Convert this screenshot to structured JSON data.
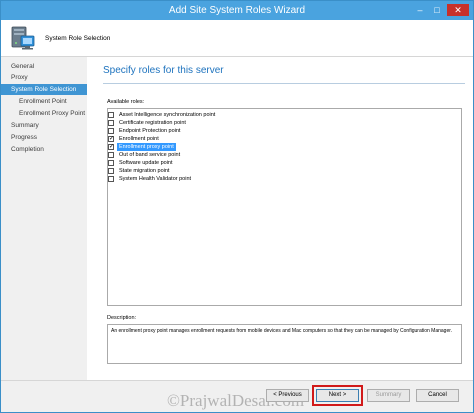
{
  "window": {
    "title": "Add Site System Roles Wizard",
    "controls": {
      "minimize": "–",
      "maximize": "□",
      "close": "✕"
    }
  },
  "header": {
    "title": "System Role Selection",
    "icon": "server-computer-icon"
  },
  "nav": {
    "items": [
      {
        "label": "General"
      },
      {
        "label": "Proxy"
      },
      {
        "label": "System Role Selection",
        "active": true
      },
      {
        "label": "Enrollment Point"
      },
      {
        "label": "Enrollment Proxy Point"
      },
      {
        "label": "Summary"
      },
      {
        "label": "Progress"
      },
      {
        "label": "Completion"
      }
    ]
  },
  "main": {
    "heading": "Specify roles for this server",
    "available_label": "Available roles:",
    "roles": [
      {
        "label": "Asset Intelligence synchronization point",
        "checked": false
      },
      {
        "label": "Certificate registration point",
        "checked": false
      },
      {
        "label": "Endpoint Protection point",
        "checked": false
      },
      {
        "label": "Enrollment point",
        "checked": true
      },
      {
        "label": "Enrollment proxy point",
        "checked": true,
        "selected": true
      },
      {
        "label": "Out of band service point",
        "checked": false
      },
      {
        "label": "Software update point",
        "checked": false
      },
      {
        "label": "State migration point",
        "checked": false
      },
      {
        "label": "System Health Validator point",
        "checked": false
      }
    ],
    "description_label": "Description:",
    "description": "An enrollment proxy point manages enrollment requests from mobile devices and Mac computers so that they can be managed by Configuration Manager."
  },
  "footer": {
    "previous": "< Previous",
    "next": "Next >",
    "summary": "Summary",
    "cancel": "Cancel"
  },
  "watermark": "©PrajwalDesai.com",
  "colors": {
    "title_bar": "#4aa3df",
    "nav_active": "#3f95d3",
    "heading": "#1e73be",
    "selection": "#3399ff",
    "highlight_box": "#d11a1a"
  }
}
